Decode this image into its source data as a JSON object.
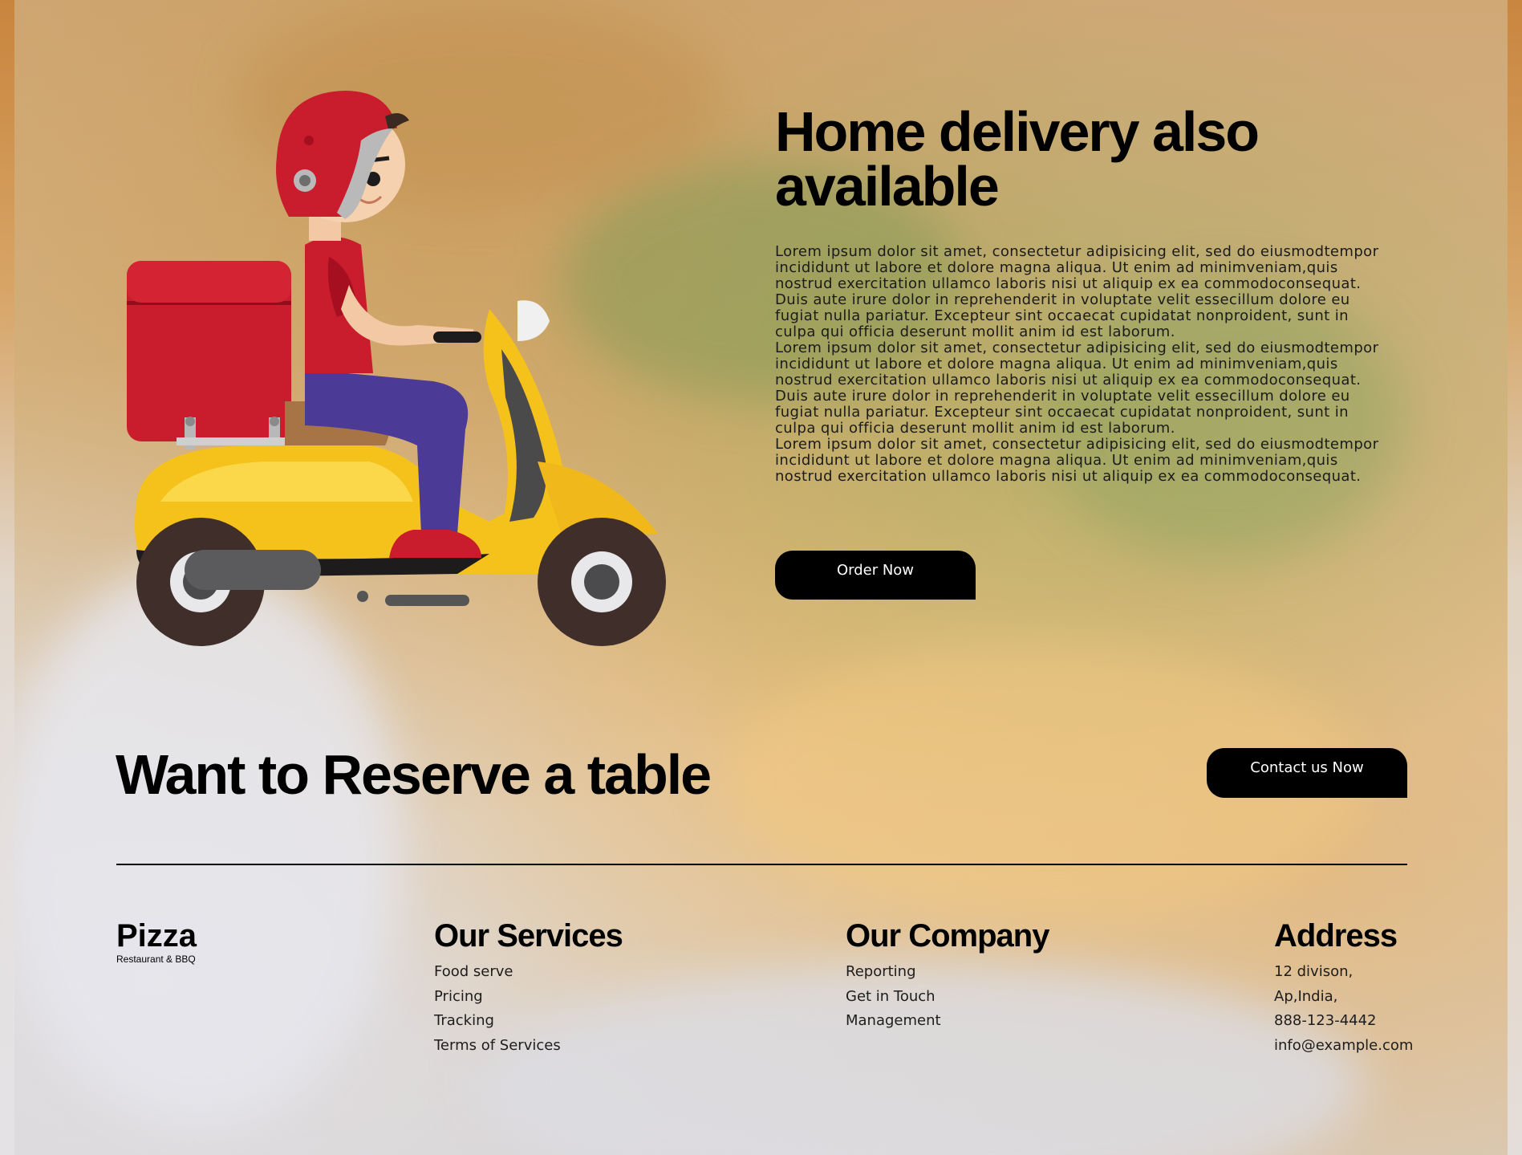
{
  "hero": {
    "title": "Home delivery also available",
    "paragraphs": [
      "Lorem ipsum dolor sit amet, consectetur adipisicing elit, sed do eiusmodtempor incididunt ut labore et dolore magna aliqua. Ut enim ad minimveniam,quis nostrud exercitation ullamco laboris nisi ut aliquip ex ea commodoconsequat.",
      "Duis aute irure dolor in reprehenderit in voluptate velit essecillum dolore eu fugiat nulla pariatur. Excepteur sint occaecat cupidatat nonproident, sunt in culpa qui officia deserunt mollit anim id est laborum.",
      "Lorem ipsum dolor sit amet, consectetur adipisicing elit, sed do eiusmodtempor incididunt ut labore et dolore magna aliqua. Ut enim ad minimveniam,quis nostrud exercitation ullamco laboris nisi ut aliquip ex ea commodoconsequat. Duis aute irure dolor in reprehenderit in voluptate velit essecillum dolore eu fugiat nulla pariatur. Excepteur sint occaecat cupidatat nonproident, sunt in culpa qui officia deserunt mollit anim id est laborum.",
      "Lorem ipsum dolor sit amet, consectetur adipisicing elit, sed do eiusmodtempor incididunt ut labore et dolore magna aliqua. Ut enim ad minimveniam,quis nostrud exercitation ullamco laboris nisi ut aliquip ex ea commodoconsequat."
    ],
    "order_button": "Order Now"
  },
  "reserve": {
    "title": "Want to Reserve a table",
    "contact_button": "Contact us Now"
  },
  "footer": {
    "brand": {
      "name": "Pizza",
      "tagline": "Restaurant & BBQ"
    },
    "services": {
      "heading": "Our Services",
      "items": [
        "Food serve",
        "Pricing",
        "Tracking",
        "Terms of Services"
      ]
    },
    "company": {
      "heading": "Our Company",
      "items": [
        "Reporting",
        "Get in Touch",
        "Management"
      ]
    },
    "address": {
      "heading": "Address",
      "items": [
        "12 divison,",
        "Ap,India,",
        "888-123-4442",
        "info@example.com"
      ]
    }
  },
  "colors": {
    "button_bg": "#000000",
    "button_text": "#ffffff",
    "helmet_red": "#c91d2e",
    "scooter_yellow": "#f5c21b",
    "pants_blue": "#4b3a96"
  },
  "icons": {
    "illustration": "delivery-scooter-illustration"
  }
}
